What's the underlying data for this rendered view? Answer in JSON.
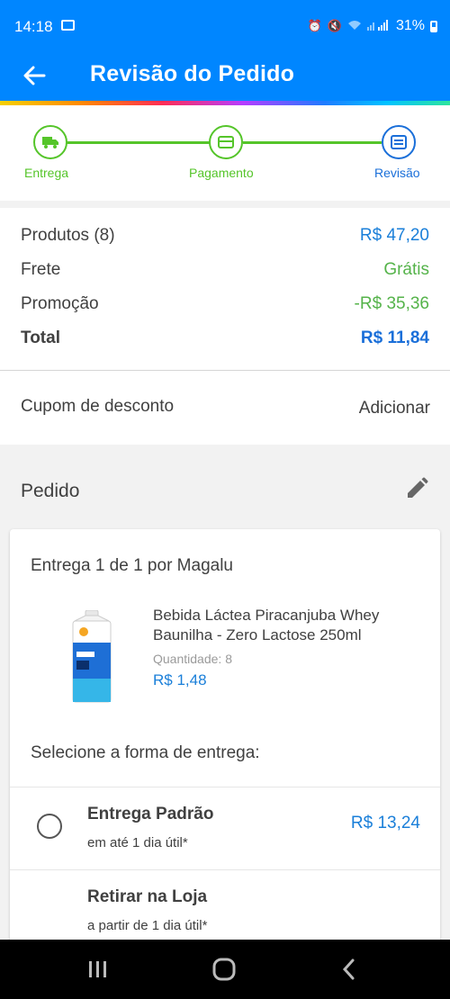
{
  "status_bar": {
    "time": "14:18",
    "battery": "31%",
    "icons": [
      "image-icon",
      "alarm-icon",
      "mute-icon",
      "wifi-icon",
      "signal-icon",
      "battery-icon"
    ]
  },
  "header": {
    "title": "Revisão do Pedido",
    "back_icon": "arrow-left-icon"
  },
  "stepper": {
    "steps": [
      {
        "label": "Entrega",
        "icon": "truck-icon",
        "state": "done"
      },
      {
        "label": "Pagamento",
        "icon": "card-icon",
        "state": "done"
      },
      {
        "label": "Revisão",
        "icon": "review-icon",
        "state": "active"
      }
    ]
  },
  "summary": {
    "products_label": "Produtos (8)",
    "products_value": "R$ 47,20",
    "shipping_label": "Frete",
    "shipping_value": "Grátis",
    "promo_label": "Promoção",
    "promo_value": "-R$ 35,36",
    "total_label": "Total",
    "total_value": "R$ 11,84"
  },
  "coupon": {
    "label": "Cupom de desconto",
    "action": "Adicionar"
  },
  "order": {
    "title": "Pedido",
    "edit_icon": "pencil-icon",
    "delivery_header": "Entrega 1 de 1 por Magalu",
    "product": {
      "name": "Bebida Láctea Piracanjuba Whey Baunilha - Zero Lactose 250ml",
      "quantity_label": "Quantidade:",
      "quantity": "8",
      "price": "R$ 1,48"
    },
    "shipping_prompt": "Selecione a forma de entrega:",
    "shipping_options": [
      {
        "title": "Entrega Padrão",
        "subtitle": "em até 1 dia útil*",
        "price": "R$ 13,24"
      },
      {
        "title": "Retirar na Loja",
        "subtitle": "a partir de 1 dia útil*",
        "price": ""
      }
    ]
  },
  "colors": {
    "primary": "#0086ff",
    "step_done": "#55c52a",
    "step_active": "#1a6fd9",
    "price_blue": "#1a7fd9",
    "green": "#55b34a"
  }
}
